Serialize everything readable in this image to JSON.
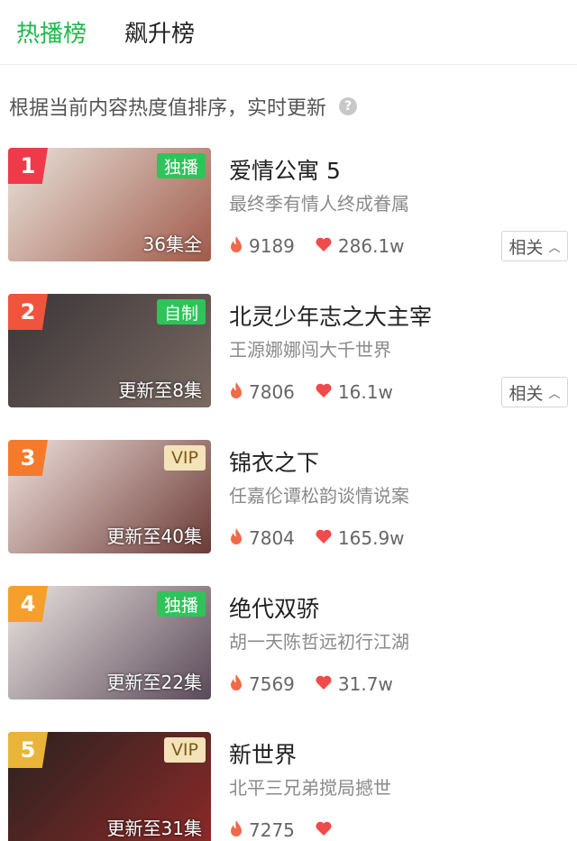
{
  "tabs": [
    {
      "label": "热播榜",
      "active": true
    },
    {
      "label": "飙升榜",
      "active": false
    }
  ],
  "subtitle": "根据当前内容热度值排序，实时更新",
  "colors": {
    "accent": "#1fb84f",
    "heat_icon": "#f06a4a",
    "like_icon": "#f04a4a"
  },
  "items": [
    {
      "rank": "1",
      "rank_color": "#ee3a4a",
      "tag": "独播",
      "tag_style": "green",
      "episodes": "36集全",
      "title": "爱情公寓 5",
      "desc": "最终季有情人终成眷属",
      "heat": "9189",
      "likes": "286.1w",
      "related": "相关",
      "poster_colors": [
        "#e8e2da",
        "#a05a4a"
      ]
    },
    {
      "rank": "2",
      "rank_color": "#f0543c",
      "tag": "自制",
      "tag_style": "green",
      "episodes": "更新至8集",
      "title": "北灵少年志之大主宰",
      "desc": "王源娜娜闯大千世界",
      "heat": "7806",
      "likes": "16.1w",
      "related": "相关",
      "poster_colors": [
        "#3a3438",
        "#7a6a62"
      ]
    },
    {
      "rank": "3",
      "rank_color": "#f57a2c",
      "tag": "VIP",
      "tag_style": "vip",
      "episodes": "更新至40集",
      "title": "锦衣之下",
      "desc": "任嘉伦谭松韵谈情说案",
      "heat": "7804",
      "likes": "165.9w",
      "related": "",
      "poster_colors": [
        "#efe1dc",
        "#6b3a36"
      ]
    },
    {
      "rank": "4",
      "rank_color": "#f5a02c",
      "tag": "独播",
      "tag_style": "green",
      "episodes": "更新至22集",
      "title": "绝代双骄",
      "desc": "胡一天陈哲远初行江湖",
      "heat": "7569",
      "likes": "31.7w",
      "related": "",
      "poster_colors": [
        "#ebe3e0",
        "#5a4a58"
      ]
    },
    {
      "rank": "5",
      "rank_color": "#e8b53a",
      "tag": "VIP",
      "tag_style": "vip",
      "episodes": "更新至31集",
      "title": "新世界",
      "desc": "北平三兄弟搅局撼世",
      "heat": "7275",
      "likes": "",
      "related": "",
      "poster_colors": [
        "#2a2220",
        "#8a2a28"
      ]
    }
  ]
}
